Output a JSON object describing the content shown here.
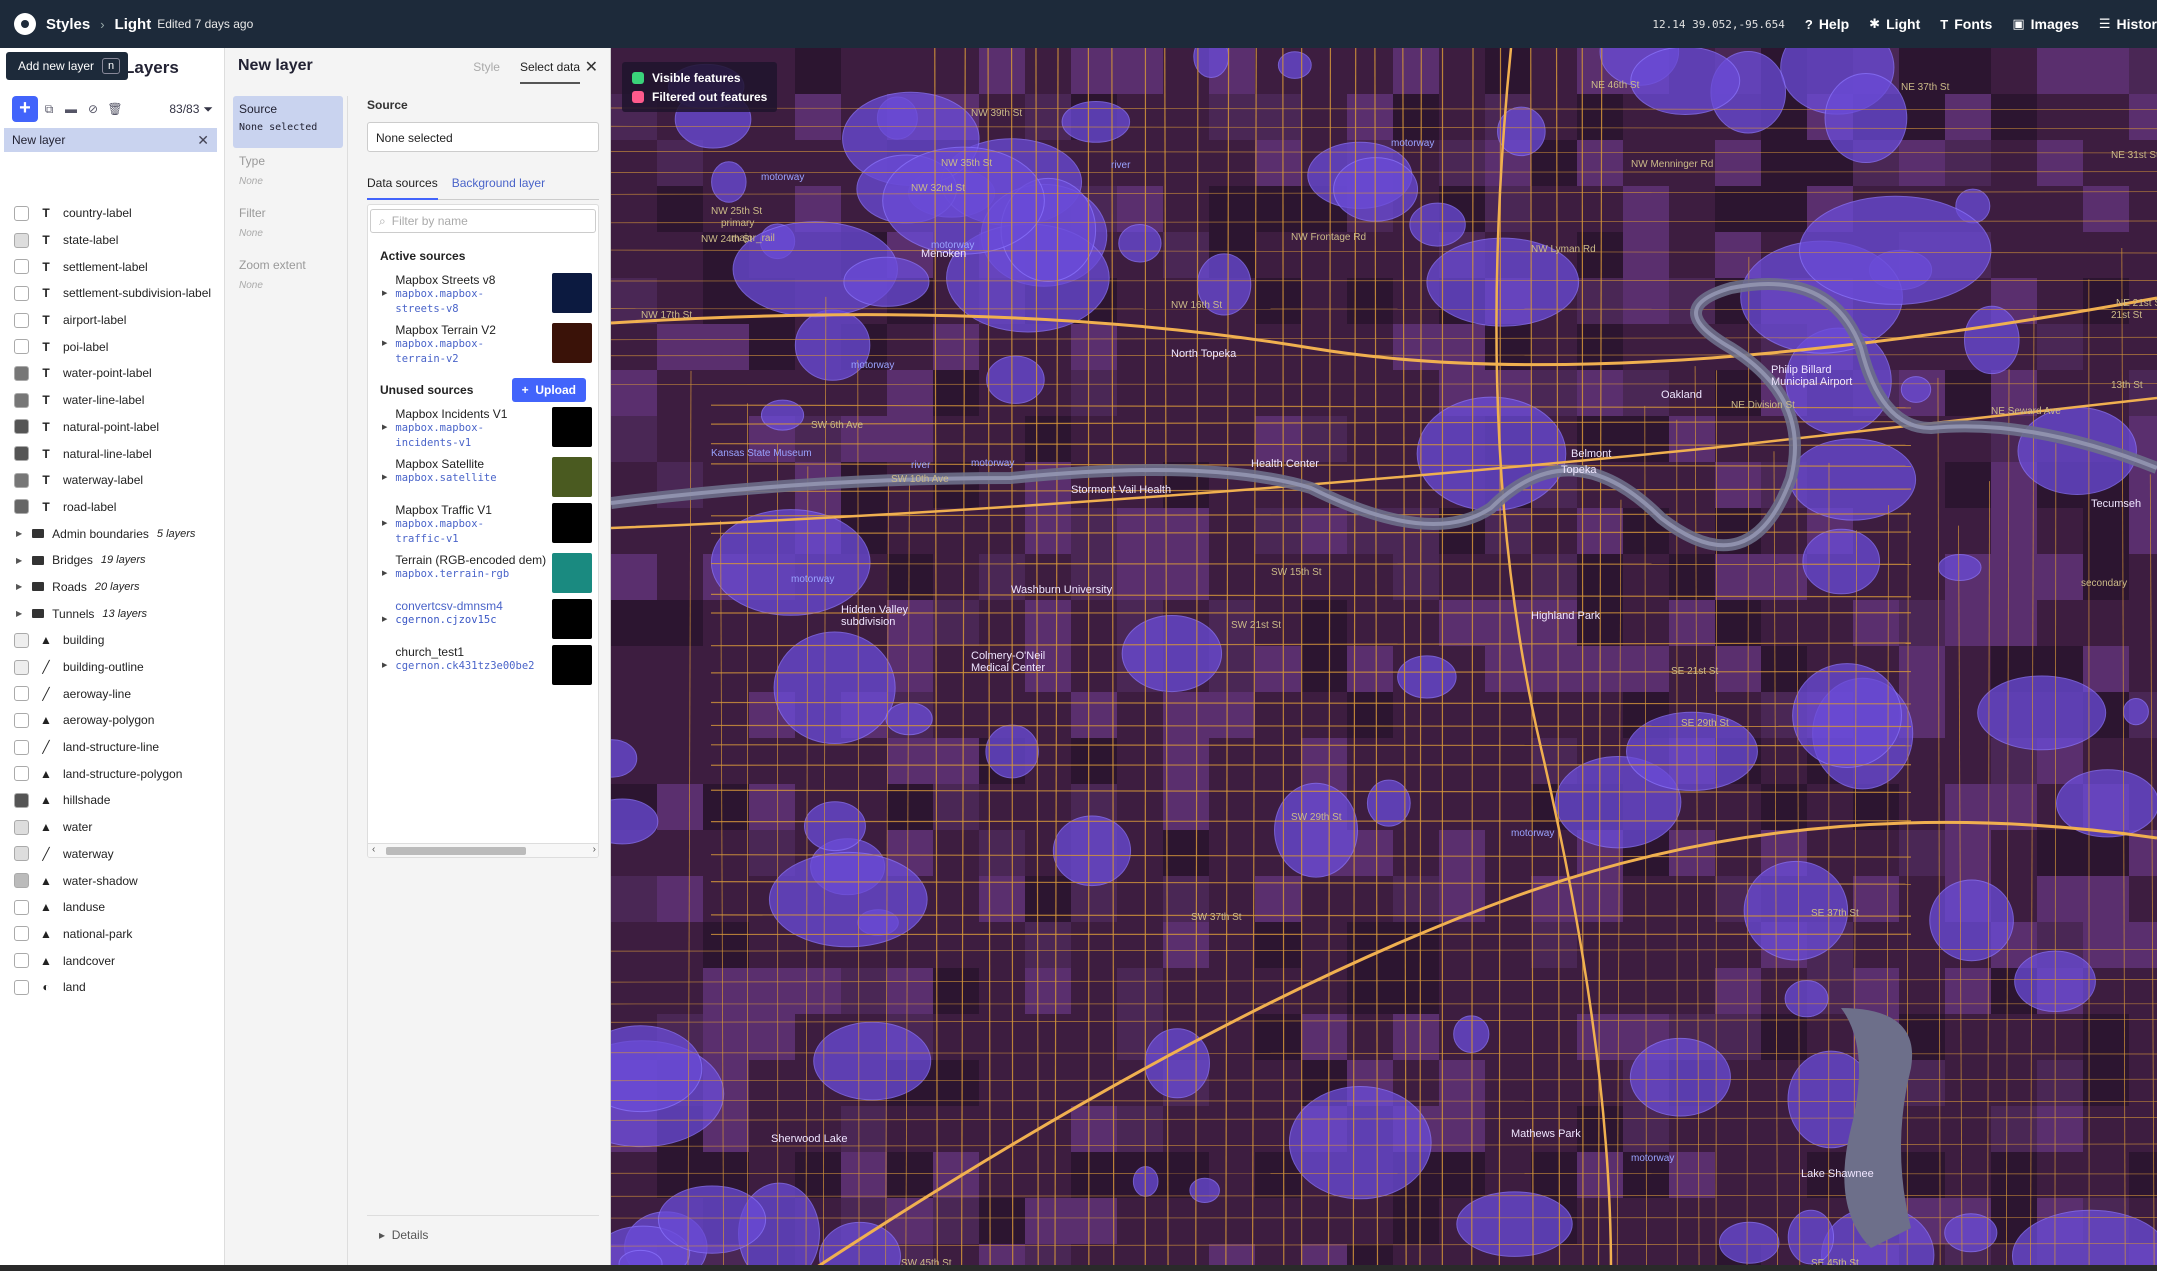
{
  "topbar": {
    "styles": "Styles",
    "style_name": "Light",
    "edited": "Edited 7 days ago",
    "coords": "12.14 39.052,-95.654",
    "help": "Help",
    "theme": "Light",
    "fonts": "Fonts",
    "images": "Images",
    "history": "Histor"
  },
  "layers_panel": {
    "title": "Layers",
    "tooltip": "Add new layer",
    "tooltip_key": "n",
    "count": "83/83",
    "new_layer": "New layer",
    "items": [
      {
        "type": "T",
        "label": "country-label",
        "swatch": "#ffffff"
      },
      {
        "type": "T",
        "label": "state-label",
        "swatch": "#dddddd"
      },
      {
        "type": "T",
        "label": "settlement-label",
        "swatch": "#ffffff"
      },
      {
        "type": "T",
        "label": "settlement-subdivision-label",
        "swatch": "#ffffff"
      },
      {
        "type": "T",
        "label": "airport-label",
        "swatch": "#ffffff"
      },
      {
        "type": "T",
        "label": "poi-label",
        "swatch": "#ffffff"
      },
      {
        "type": "T",
        "label": "water-point-label",
        "swatch": "#777777"
      },
      {
        "type": "T",
        "label": "water-line-label",
        "swatch": "#777777"
      },
      {
        "type": "T",
        "label": "natural-point-label",
        "swatch": "#555555"
      },
      {
        "type": "T",
        "label": "natural-line-label",
        "swatch": "#555555"
      },
      {
        "type": "T",
        "label": "waterway-label",
        "swatch": "#777777"
      },
      {
        "type": "T",
        "label": "road-label",
        "swatch": "#666666"
      }
    ],
    "groups": [
      {
        "label": "Admin boundaries",
        "count": "5 layers"
      },
      {
        "label": "Bridges",
        "count": "19 layers"
      },
      {
        "label": "Roads",
        "count": "20 layers"
      },
      {
        "label": "Tunnels",
        "count": "13 layers"
      }
    ],
    "items2": [
      {
        "type": "fill",
        "label": "building",
        "swatch": "#eeeeee"
      },
      {
        "type": "line",
        "label": "building-outline",
        "swatch": "#eeeeee"
      },
      {
        "type": "line",
        "label": "aeroway-line",
        "swatch": "#ffffff"
      },
      {
        "type": "fill",
        "label": "aeroway-polygon",
        "swatch": "#ffffff"
      },
      {
        "type": "line",
        "label": "land-structure-line",
        "swatch": "#ffffff"
      },
      {
        "type": "fill",
        "label": "land-structure-polygon",
        "swatch": "#ffffff"
      },
      {
        "type": "fill",
        "label": "hillshade",
        "swatch": "#555555"
      },
      {
        "type": "fill",
        "label": "water",
        "swatch": "#dddddd"
      },
      {
        "type": "line",
        "label": "waterway",
        "swatch": "#dddddd"
      },
      {
        "type": "fill",
        "label": "water-shadow",
        "swatch": "#bbbbbb"
      },
      {
        "type": "fill",
        "label": "landuse",
        "swatch": "#ffffff"
      },
      {
        "type": "fill",
        "label": "national-park",
        "swatch": "#ffffff"
      },
      {
        "type": "fill",
        "label": "landcover",
        "swatch": "#ffffff"
      },
      {
        "type": "bg",
        "label": "land",
        "swatch": "#ffffff"
      }
    ]
  },
  "new_layer": {
    "title": "New layer",
    "tab_style": "Style",
    "tab_select": "Select data",
    "steps": [
      {
        "label": "Source",
        "value": "None selected"
      },
      {
        "label": "Type",
        "value": "None"
      },
      {
        "label": "Filter",
        "value": "None"
      },
      {
        "label": "Zoom extent",
        "value": "None"
      }
    ],
    "source_label": "Source",
    "source_value": "None selected",
    "subtab_data": "Data sources",
    "subtab_bg": "Background layer",
    "filter_placeholder": "Filter by name",
    "active_title": "Active sources",
    "unused_title": "Unused sources",
    "upload": "Upload",
    "active_sources": [
      {
        "name": "Mapbox Streets v8",
        "id1": "mapbox.mapbox-",
        "id2": "streets-v8",
        "thumb": "#0c1a40"
      },
      {
        "name": "Mapbox Terrain V2",
        "id1": "mapbox.mapbox-",
        "id2": "terrain-v2",
        "thumb": "#3a1208"
      }
    ],
    "unused_sources": [
      {
        "name": "Mapbox Incidents V1",
        "id1": "mapbox.mapbox-",
        "id2": "incidents-v1",
        "thumb": "#000000"
      },
      {
        "name": "Mapbox Satellite",
        "id1": "mapbox.satellite",
        "id2": "",
        "thumb": "#4a5a20"
      },
      {
        "name": "Mapbox Traffic V1",
        "id1": "mapbox.mapbox-",
        "id2": "traffic-v1",
        "thumb": "#000000"
      },
      {
        "name": "Terrain (RGB-encoded dem)",
        "id1": "mapbox.terrain-rgb",
        "id2": "",
        "thumb": "#1a8a80"
      },
      {
        "name": "convertcsv-dmnsm4",
        "id1": "cgernon.cjzov15c",
        "id2": "",
        "thumb": "#000000"
      },
      {
        "name": "church_test1",
        "id1": "cgernon.ck431tz3e00be2",
        "id2": "",
        "thumb": "#000000"
      }
    ],
    "details": "Details"
  },
  "map": {
    "legend_visible": "Visible features",
    "legend_filtered": "Filtered out features",
    "visible_color": "#3ad37a",
    "filtered_color": "#ff5a8c",
    "labels": [
      {
        "t": "NW 39th St",
        "k": "road"
      },
      {
        "t": "NW 35th St",
        "k": "road"
      },
      {
        "t": "NW 32nd St",
        "k": "road"
      },
      {
        "t": "NW 25th St",
        "k": "road"
      },
      {
        "t": "NW 24th St",
        "k": "road"
      },
      {
        "t": "NW 17th St",
        "k": "road"
      },
      {
        "t": "NW 16th St",
        "k": "road"
      },
      {
        "t": "NW Menninger Rd",
        "k": "road"
      },
      {
        "t": "NW Lyman Rd",
        "k": "road"
      },
      {
        "t": "NW Frontage Rd",
        "k": "road"
      },
      {
        "t": "NE 46th St",
        "k": "road"
      },
      {
        "t": "NE 37th St",
        "k": "road"
      },
      {
        "t": "NE 31st St",
        "k": "road"
      },
      {
        "t": "NE 21st St",
        "k": "road"
      },
      {
        "t": "NE Seward Ave",
        "k": "road"
      },
      {
        "t": "NE Division St",
        "k": "road"
      },
      {
        "t": "SW 6th Ave",
        "k": "road"
      },
      {
        "t": "SW 10th Ave",
        "k": "road"
      },
      {
        "t": "SW 15th St",
        "k": "road"
      },
      {
        "t": "SW 21st St",
        "k": "road"
      },
      {
        "t": "SW 29th St",
        "k": "road"
      },
      {
        "t": "SW 37th St",
        "k": "road"
      },
      {
        "t": "SW 45th St",
        "k": "road"
      },
      {
        "t": "SE 21st St",
        "k": "road"
      },
      {
        "t": "SE 29th St",
        "k": "road"
      },
      {
        "t": "SE 37th St",
        "k": "road"
      },
      {
        "t": "SE 45th St",
        "k": "road"
      },
      {
        "t": "13th St",
        "k": "road"
      },
      {
        "t": "21st St",
        "k": "road"
      },
      {
        "t": "motorway",
        "k": "mw"
      },
      {
        "t": "motorway",
        "k": "mw"
      },
      {
        "t": "motorway",
        "k": "mw"
      },
      {
        "t": "motorway",
        "k": "mw"
      },
      {
        "t": "motorway",
        "k": "mw"
      },
      {
        "t": "motorway",
        "k": "mw"
      },
      {
        "t": "motorway",
        "k": "mw"
      },
      {
        "t": "motorway",
        "k": "mw"
      },
      {
        "t": "river",
        "k": "mw"
      },
      {
        "t": "river",
        "k": "mw"
      },
      {
        "t": "Menoken",
        "k": "place"
      },
      {
        "t": "North Topeka",
        "k": "place"
      },
      {
        "t": "Philip Billard",
        "k": "place"
      },
      {
        "t": "Municipal Airport",
        "k": "place"
      },
      {
        "t": "Oakland",
        "k": "place"
      },
      {
        "t": "Topeka",
        "k": "place"
      },
      {
        "t": "Stormont Vail Health",
        "k": "place"
      },
      {
        "t": "Washburn University",
        "k": "place"
      },
      {
        "t": "Hidden Valley",
        "k": "place"
      },
      {
        "t": "subdivision",
        "k": "place"
      },
      {
        "t": "Highland Park",
        "k": "place"
      },
      {
        "t": "Colmery-O'Neil",
        "k": "place"
      },
      {
        "t": "Medical Center",
        "k": "place"
      },
      {
        "t": "Sherwood Lake",
        "k": "place"
      },
      {
        "t": "Mathews Park",
        "k": "place"
      },
      {
        "t": "Lake Shawnee",
        "k": "place"
      },
      {
        "t": "Belmont",
        "k": "place"
      },
      {
        "t": "Tecumseh",
        "k": "place"
      },
      {
        "t": "primary",
        "k": "road"
      },
      {
        "t": "major_rail",
        "k": "road"
      },
      {
        "t": "secondary",
        "k": "road"
      },
      {
        "t": "Kansas State Museum",
        "k": "mw"
      },
      {
        "t": "Health Center",
        "k": "place"
      }
    ]
  }
}
